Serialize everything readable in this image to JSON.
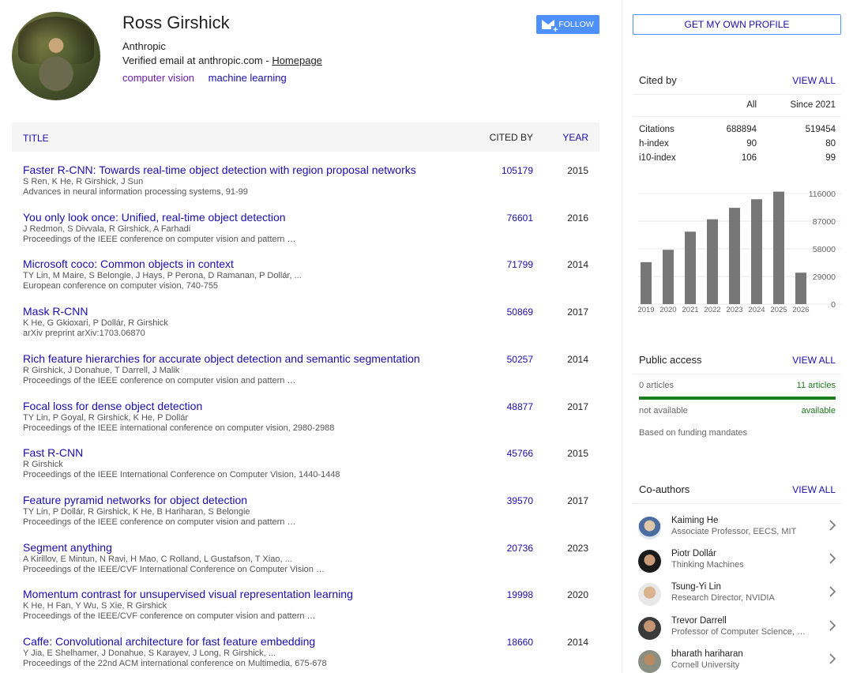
{
  "profile": {
    "name": "Ross Girshick",
    "affiliation": "Anthropic",
    "email_text": "Verified email at anthropic.com - ",
    "homepage_label": "Homepage",
    "interests": [
      "computer vision",
      "machine learning"
    ],
    "follow_label": "FOLLOW"
  },
  "table": {
    "col_title": "TITLE",
    "col_cited": "CITED BY",
    "col_year": "YEAR"
  },
  "articles": [
    {
      "title": "Faster R-CNN: Towards real-time object detection with region proposal networks",
      "authors": "S Ren, K He, R Girshick, J Sun",
      "venue": "Advances in neural information processing systems, 91-99",
      "cited": "105179",
      "year": "2015"
    },
    {
      "title": "You only look once: Unified, real-time object detection",
      "authors": "J Redmon, S Divvala, R Girshick, A Farhadi",
      "venue": "Proceedings of the IEEE conference on computer vision and pattern …",
      "cited": "76601",
      "year": "2016"
    },
    {
      "title": "Microsoft coco: Common objects in context",
      "authors": "TY Lin, M Maire, S Belongie, J Hays, P Perona, D Ramanan, P Dollár, ...",
      "venue": "European conference on computer vision, 740-755",
      "cited": "71799",
      "year": "2014"
    },
    {
      "title": "Mask R-CNN",
      "authors": "K He, G Gkioxari, P Dollár, R Girshick",
      "venue": "arXiv preprint arXiv:1703.06870",
      "cited": "50869",
      "year": "2017"
    },
    {
      "title": "Rich feature hierarchies for accurate object detection and semantic segmentation",
      "authors": "R Girshick, J Donahue, T Darrell, J Malik",
      "venue": "Proceedings of the IEEE conference on computer vision and pattern …",
      "cited": "50257",
      "year": "2014"
    },
    {
      "title": "Focal loss for dense object detection",
      "authors": "TY Lin, P Goyal, R Girshick, K He, P Dollár",
      "venue": "Proceedings of the IEEE international conference on computer vision, 2980-2988",
      "cited": "48877",
      "year": "2017"
    },
    {
      "title": "Fast R-CNN",
      "authors": "R Girshick",
      "venue": "Proceedings of the IEEE International Conference on Computer Vision, 1440-1448",
      "cited": "45766",
      "year": "2015"
    },
    {
      "title": "Feature pyramid networks for object detection",
      "authors": "TY Lin, P Dollár, R Girshick, K He, B Hariharan, S Belongie",
      "venue": "Proceedings of the IEEE conference on computer vision and pattern …",
      "cited": "39570",
      "year": "2017"
    },
    {
      "title": "Segment anything",
      "authors": "A Kirillov, E Mintun, N Ravi, H Mao, C Rolland, L Gustafson, T Xiao, ...",
      "venue": "Proceedings of the IEEE/CVF International Conference on Computer Vision …",
      "cited": "20736",
      "year": "2023"
    },
    {
      "title": "Momentum contrast for unsupervised visual representation learning",
      "authors": "K He, H Fan, Y Wu, S Xie, R Girshick",
      "venue": "Proceedings of the IEEE/CVF conference on computer vision and pattern …",
      "cited": "19998",
      "year": "2020"
    },
    {
      "title": "Caffe: Convolutional architecture for fast feature embedding",
      "authors": "Y Jia, E Shelhamer, J Donahue, S Karayev, J Long, R Girshick, ...",
      "venue": "Proceedings of the 22nd ACM international conference on Multimedia, 675-678",
      "cited": "18660",
      "year": "2014"
    }
  ],
  "sidebar": {
    "profile_button": "GET MY OWN PROFILE",
    "view_all": "VIEW ALL",
    "cited_by": {
      "title": "Cited by",
      "col_all": "All",
      "col_since": "Since 2021",
      "rows": [
        {
          "label": "Citations",
          "all": "688894",
          "since": "519454"
        },
        {
          "label": "h-index",
          "all": "90",
          "since": "80"
        },
        {
          "label": "i10-index",
          "all": "106",
          "since": "99"
        }
      ]
    },
    "public_access": {
      "title": "Public access",
      "left_count": "0 articles",
      "right_count": "11 articles",
      "left_label": "not available",
      "right_label": "available",
      "note": "Based on funding mandates",
      "available_color": "#1e7b1e"
    },
    "coauthors": {
      "title": "Co-authors",
      "items": [
        {
          "name": "Kaiming He",
          "affiliation": "Associate Professor, EECS, MIT"
        },
        {
          "name": "Piotr Dollár",
          "affiliation": "Thinking Machines"
        },
        {
          "name": "Tsung-Yi Lin",
          "affiliation": "Research Director, NVIDIA"
        },
        {
          "name": "Trevor Darrell",
          "affiliation": "Professor of Computer Science, …"
        },
        {
          "name": "bharath hariharan",
          "affiliation": "Cornell University"
        }
      ]
    }
  },
  "chart_data": {
    "type": "bar",
    "categories": [
      "2019",
      "2020",
      "2021",
      "2022",
      "2023",
      "2024",
      "2025",
      "2026"
    ],
    "values": [
      44000,
      57000,
      76000,
      89000,
      101000,
      110000,
      118000,
      33000
    ],
    "ylim": [
      0,
      116000
    ],
    "yticks": [
      "116000",
      "87000",
      "58000",
      "29000",
      "0"
    ],
    "ytick_values": [
      116000,
      87000,
      58000,
      29000,
      0
    ],
    "bar_color": "#777777",
    "grid": true
  },
  "colors": {
    "link": "#1a0dab",
    "accent": "#4d90fe",
    "interest": "#6b1bac"
  }
}
